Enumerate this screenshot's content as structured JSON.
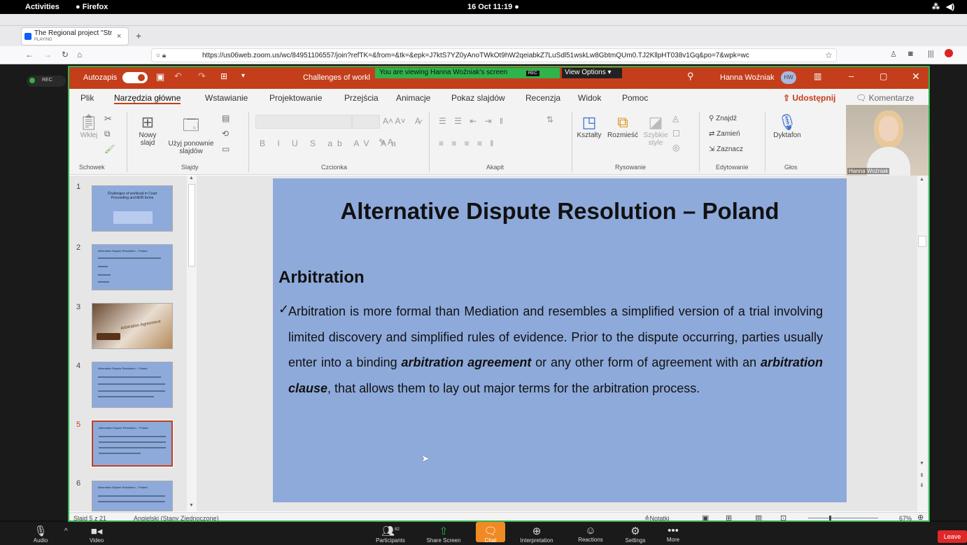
{
  "os_bar": {
    "activities": "Activities",
    "app": "Firefox",
    "clock": "16 Oct 11:19"
  },
  "browser": {
    "tab_title": "The Regional project \"Str",
    "tab_sub": "PLAYING",
    "url": "https://us06web.zoom.us/wc/84951106557/join?refTK=&from=&tk=&epk=J7ktS7YZ0yAnoTWkOt9hW2qeiabkZ7LuSdl51wskLw8GbtmQUm0.TJ2KllpHT038v1Gq&po=7&wpk=wc"
  },
  "zoom": {
    "rec": "REC",
    "viewing_banner": "You are viewing Hanna Woźniak's screen",
    "banner_rec": "REC",
    "view_options": "View Options",
    "participant_name": "Hanna Woźniak",
    "participant_count": "82",
    "leave": "Leave",
    "toolbar": [
      {
        "label": "Audio",
        "icon": "microphone-icon"
      },
      {
        "label": "Video",
        "icon": "camera-icon"
      },
      {
        "label": "Participants",
        "icon": "people-icon"
      },
      {
        "label": "Share Screen",
        "icon": "share-icon"
      },
      {
        "label": "Chat",
        "icon": "chat-icon"
      },
      {
        "label": "Interpretation",
        "icon": "globe-icon"
      },
      {
        "label": "Reactions",
        "icon": "smile-icon"
      },
      {
        "label": "Settings",
        "icon": "gear-icon"
      },
      {
        "label": "More",
        "icon": "dots-icon"
      }
    ]
  },
  "ppt": {
    "autosave": "Autozapis",
    "title": "Challenges of workl",
    "search_user": "Hanna Woźniak",
    "user_initials": "HW",
    "menu": [
      "Plik",
      "Narzędzia główne",
      "Wstawianie",
      "Projektowanie",
      "Przejścia",
      "Animacje",
      "Pokaz slajdów",
      "Recenzja",
      "Widok",
      "Pomoc"
    ],
    "share_btn": "Udostępnij",
    "comments_btn": "Komentarze",
    "ribbon": {
      "paste": "Wklej",
      "new_slide": "Nowy slajd",
      "reuse_slides": "Użyj ponownie slajdów",
      "shapes": "Kształty",
      "arrange": "Rozmieść",
      "quick_styles": "Szybkie style",
      "find": "Znajdź",
      "replace": "Zamień",
      "select": "Zaznacz",
      "dictate": "Dyktafon",
      "groups": [
        "Schowek",
        "Slajdy",
        "Czcionka",
        "Akapit",
        "Rysowanie",
        "Edytowanie",
        "Głos"
      ]
    },
    "thumbs": [
      {
        "num": "1",
        "title": "Challenges of workload in Court Proceeding and ADR forms"
      },
      {
        "num": "2",
        "title": "Alternative Dispute Resolution – Poland"
      },
      {
        "num": "3",
        "title": "Arbitration Agreement"
      },
      {
        "num": "4",
        "title": "Alternative Dispute Resolution – Poland"
      },
      {
        "num": "5",
        "title": "Alternative Dispute Resolution – Poland"
      },
      {
        "num": "6",
        "title": "Alternative Dispute Resolution – Poland"
      }
    ],
    "slide": {
      "title": "Alternative Dispute Resolution – Poland",
      "heading": "Arbitration",
      "check": "✓",
      "p1": "Arbitration is more formal than Mediation and resembles a simplified version of a trial involving limited discovery and simplified rules of evidence. Prior to the dispute occurring, parties usually enter into a binding ",
      "b1": "arbitration agreement",
      "p2": " or any other form of agreement with an ",
      "b2": "arbitration clause",
      "p3": ", that allows them to lay out major terms for the arbitration process."
    },
    "status": {
      "slide_of": "Slajd 5 z 21",
      "language": "Angielski (Stany Zjednoczone)",
      "notes": "Notatki",
      "zoom": "67%"
    }
  },
  "colors": {
    "ppt_red": "#c43e1c",
    "slide_bg": "#8eaadb",
    "zoom_green": "#2fb34a"
  }
}
